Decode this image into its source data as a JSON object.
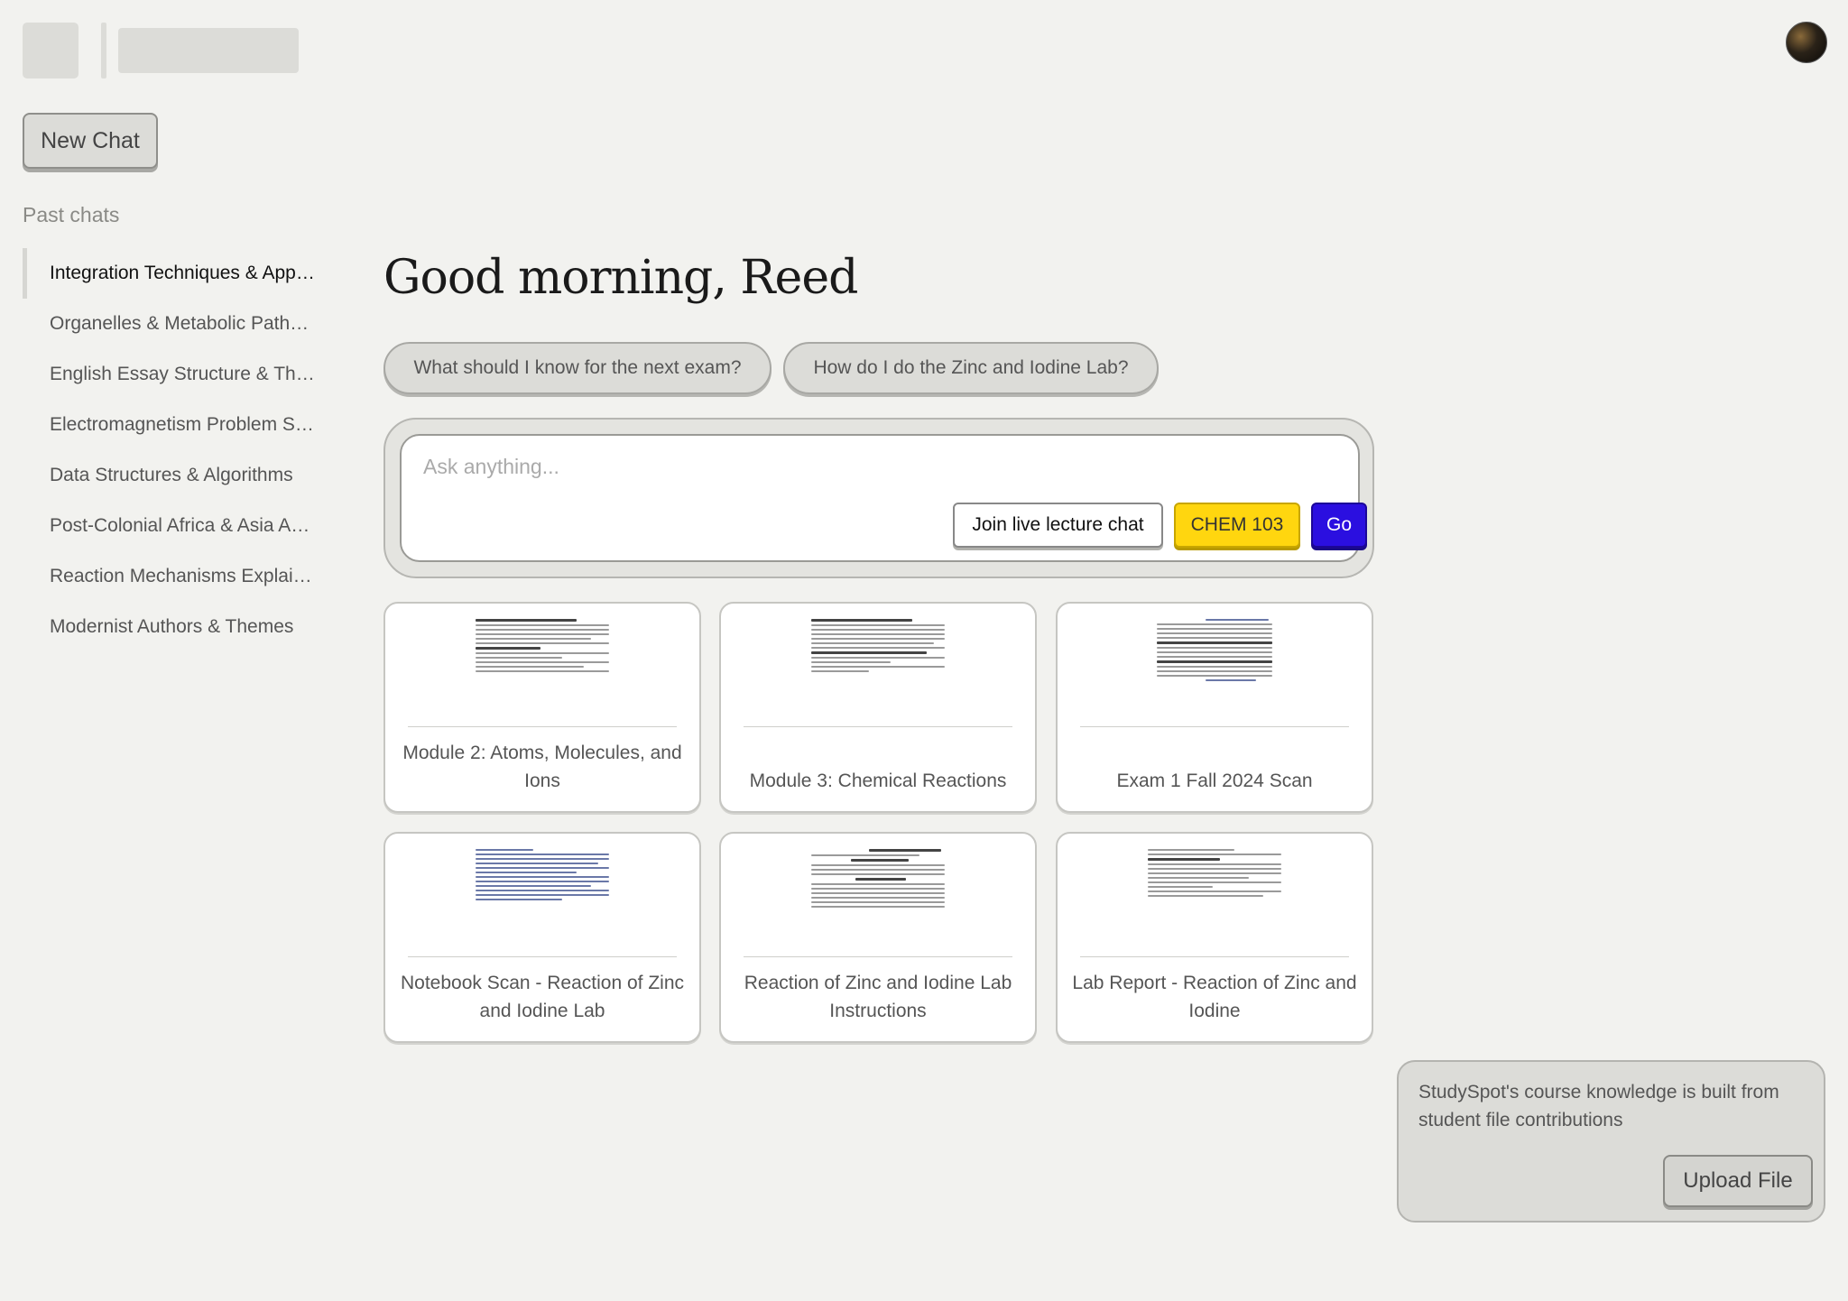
{
  "sidebar": {
    "new_chat_label": "New Chat",
    "past_chats_title": "Past chats",
    "chats": [
      "Integration Techniques & App…",
      "Organelles & Metabolic Path…",
      "English Essay Structure & Th…",
      "Electromagnetism Problem S…",
      "Data Structures & Algorithms",
      "Post-Colonial Africa & Asia A…",
      "Reaction Mechanisms Explai…",
      "Modernist Authors & Themes"
    ]
  },
  "main": {
    "greeting": "Good morning, Reed",
    "suggestions": [
      "What should I know for the next exam?",
      "How do I do the Zinc and Iodine Lab?"
    ],
    "composer": {
      "placeholder": "Ask anything...",
      "live_chat_label": "Join live lecture chat",
      "course_label": "CHEM 103",
      "go_label": "Go"
    },
    "files": [
      "Module 2: Atoms, Molecules, and Ions",
      "Module 3: Chemical Reactions",
      "Exam 1 Fall 2024 Scan",
      "Notebook Scan - Reaction of Zinc and Iodine Lab",
      "Reaction of Zinc and Iodine Lab Instructions",
      "Lab Report - Reaction of Zinc and Iodine"
    ]
  },
  "info": {
    "text": "StudySpot's course knowledge is built from student file contributions",
    "upload_label": "Upload File"
  },
  "colors": {
    "background": "#f2f2ef",
    "course_badge": "#ffd60f",
    "go_button": "#2b0fe0"
  }
}
